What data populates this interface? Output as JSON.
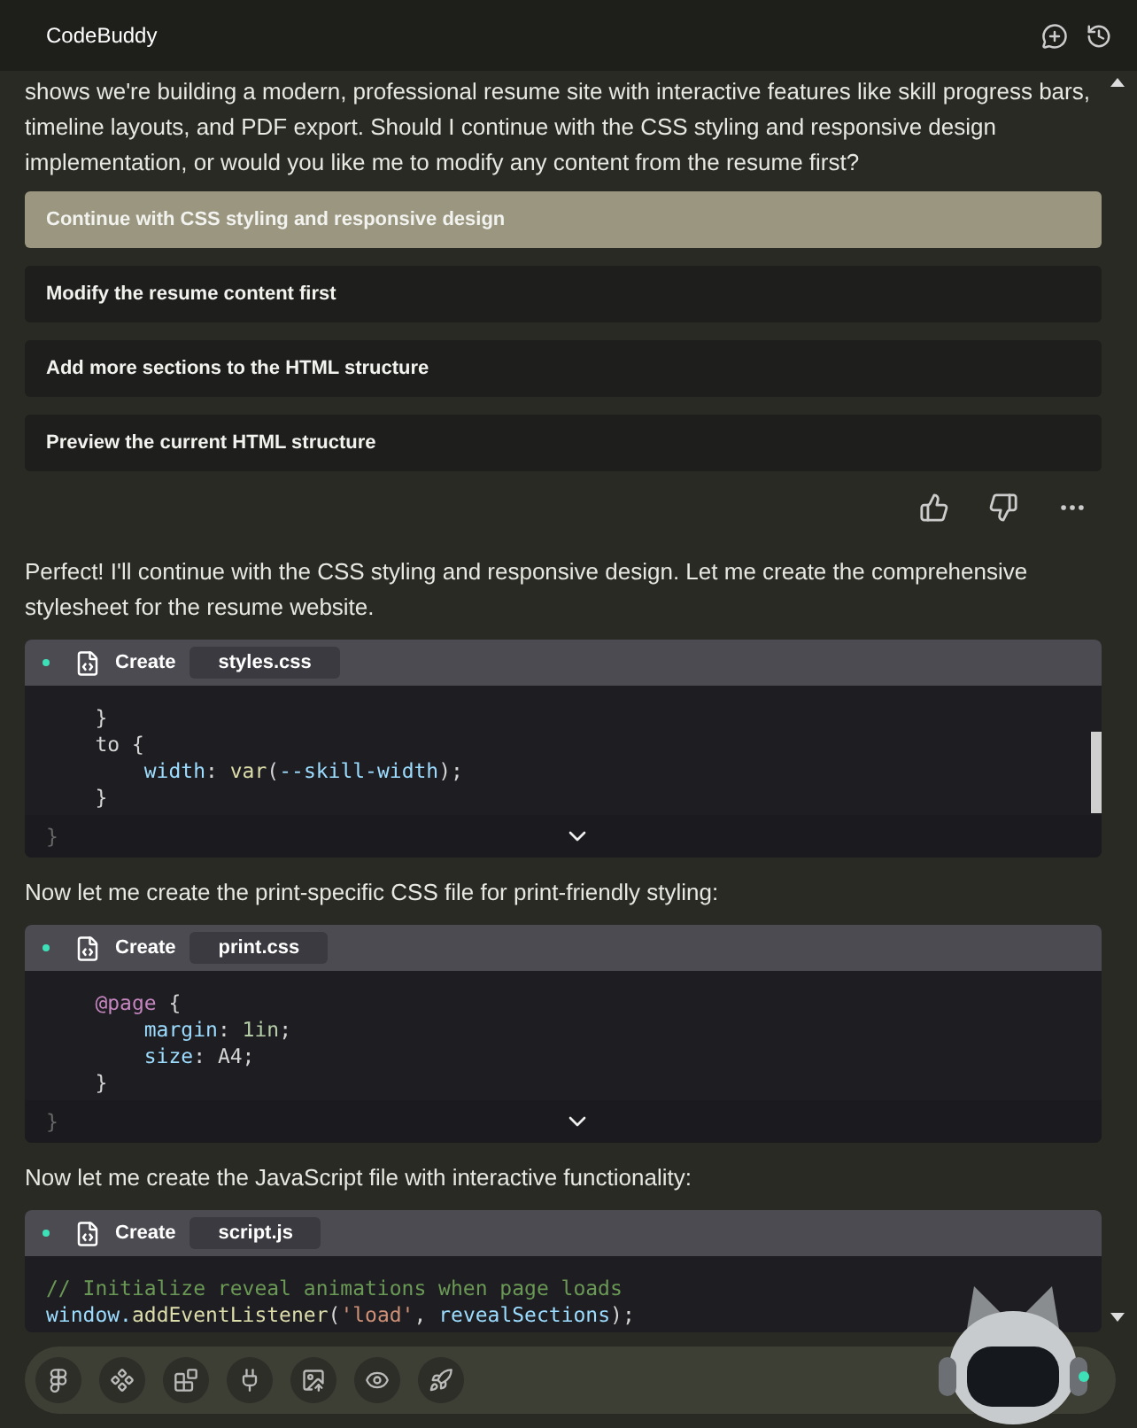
{
  "header": {
    "title": "CodeBuddy"
  },
  "intro": "shows we're building a modern, professional resume site with interactive features like skill progress bars, timeline layouts, and PDF export. Should I continue with the CSS styling and responsive design implementation, or would you like me to modify any content from the resume first?",
  "options": [
    {
      "label": "Continue with CSS styling and responsive design",
      "selected": true
    },
    {
      "label": "Modify the resume content first",
      "selected": false
    },
    {
      "label": "Add more sections to the HTML structure",
      "selected": false
    },
    {
      "label": "Preview the current HTML structure",
      "selected": false
    }
  ],
  "blocks": [
    {
      "kind": "text",
      "text": "Perfect! I'll continue with the CSS styling and responsive design. Let me create the comprehensive stylesheet for the resume website."
    },
    {
      "kind": "code",
      "action": "Create",
      "file": "styles.css",
      "scrollable": true,
      "lines": [
        [
          {
            "t": "    }",
            "kind": "plain"
          }
        ],
        [
          {
            "t": "    to {",
            "kind": "plain"
          }
        ],
        [
          {
            "t": "        width",
            "kind": "property"
          },
          {
            "t": ": ",
            "kind": "plain"
          },
          {
            "t": "var",
            "kind": "func"
          },
          {
            "t": "(",
            "kind": "plain"
          },
          {
            "t": "--skill-width",
            "kind": "property"
          },
          {
            "t": ");",
            "kind": "plain"
          }
        ],
        [
          {
            "t": "    }",
            "kind": "plain"
          }
        ]
      ],
      "footer": "}"
    },
    {
      "kind": "text",
      "text": "Now let me create the print-specific CSS file for print-friendly styling:"
    },
    {
      "kind": "code",
      "action": "Create",
      "file": "print.css",
      "scrollable": false,
      "lines": [
        [
          {
            "t": "    @page",
            "kind": "keyword"
          },
          {
            "t": " {",
            "kind": "plain"
          }
        ],
        [
          {
            "t": "        margin",
            "kind": "property"
          },
          {
            "t": ": ",
            "kind": "plain"
          },
          {
            "t": "1in",
            "kind": "number"
          },
          {
            "t": ";",
            "kind": "plain"
          }
        ],
        [
          {
            "t": "        size",
            "kind": "property"
          },
          {
            "t": ": A4;",
            "kind": "plain"
          }
        ],
        [
          {
            "t": "    }",
            "kind": "plain"
          }
        ]
      ],
      "footer": "}"
    },
    {
      "kind": "text",
      "text": "Now let me create the JavaScript file with interactive functionality:"
    },
    {
      "kind": "code",
      "action": "Create",
      "file": "script.js",
      "scrollable": false,
      "lines": [
        [
          {
            "t": "// Initialize reveal animations when page loads",
            "kind": "comment"
          }
        ],
        [
          {
            "t": "window.",
            "kind": "property"
          },
          {
            "t": "addEventListener",
            "kind": "func"
          },
          {
            "t": "(",
            "kind": "plain"
          },
          {
            "t": "'load'",
            "kind": "string"
          },
          {
            "t": ", ",
            "kind": "plain"
          },
          {
            "t": "revealSections",
            "kind": "property"
          },
          {
            "t": ");",
            "kind": "plain"
          }
        ]
      ]
    }
  ]
}
